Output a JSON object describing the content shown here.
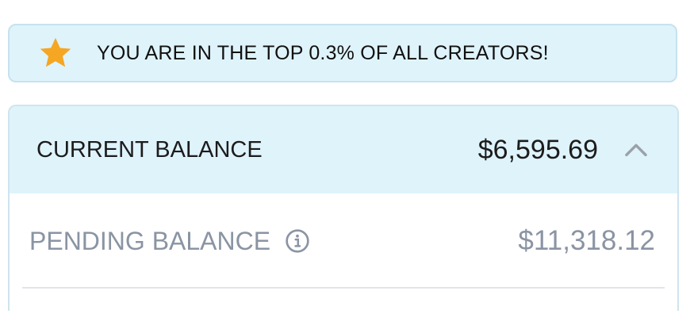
{
  "banner": {
    "icon": "star-icon",
    "text": "YOU ARE IN THE TOP 0.3% OF ALL CREATORS!",
    "star_color": "#f5a623"
  },
  "balances": {
    "current": {
      "label": "CURRENT BALANCE",
      "amount": "$6,595.69",
      "toggle_icon": "chevron-up-icon"
    },
    "pending": {
      "label": "PENDING BALANCE",
      "amount": "$11,318.12",
      "info_icon": "info-icon"
    }
  },
  "colors": {
    "accent_bg": "#dff3fb",
    "muted_text": "#8a94a3",
    "dark_text": "#1c1c1c"
  }
}
